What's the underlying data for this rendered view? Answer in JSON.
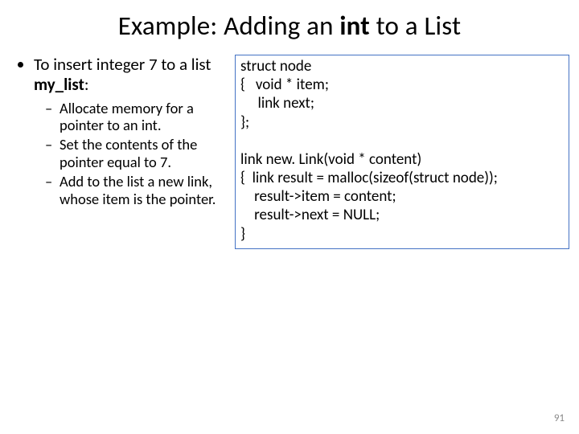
{
  "title": {
    "pre": "Example: Adding an ",
    "bold": "int",
    "post": " to a List"
  },
  "left": {
    "main_pre": "To insert integer 7 to a list ",
    "main_bold": "my_list",
    "main_post": ":",
    "sub1": "Allocate memory for a pointer to an int.",
    "sub2": "Set the contents of the pointer equal to 7.",
    "sub3": "Add to the list a new link, whose item is the pointer."
  },
  "code": "struct node\n{   void * item;\n     link next;\n};\n\nlink new. Link(void * content)\n{  link result = malloc(sizeof(struct node));\n    result->item = content;\n    result->next = NULL;\n}",
  "page_number": "91"
}
